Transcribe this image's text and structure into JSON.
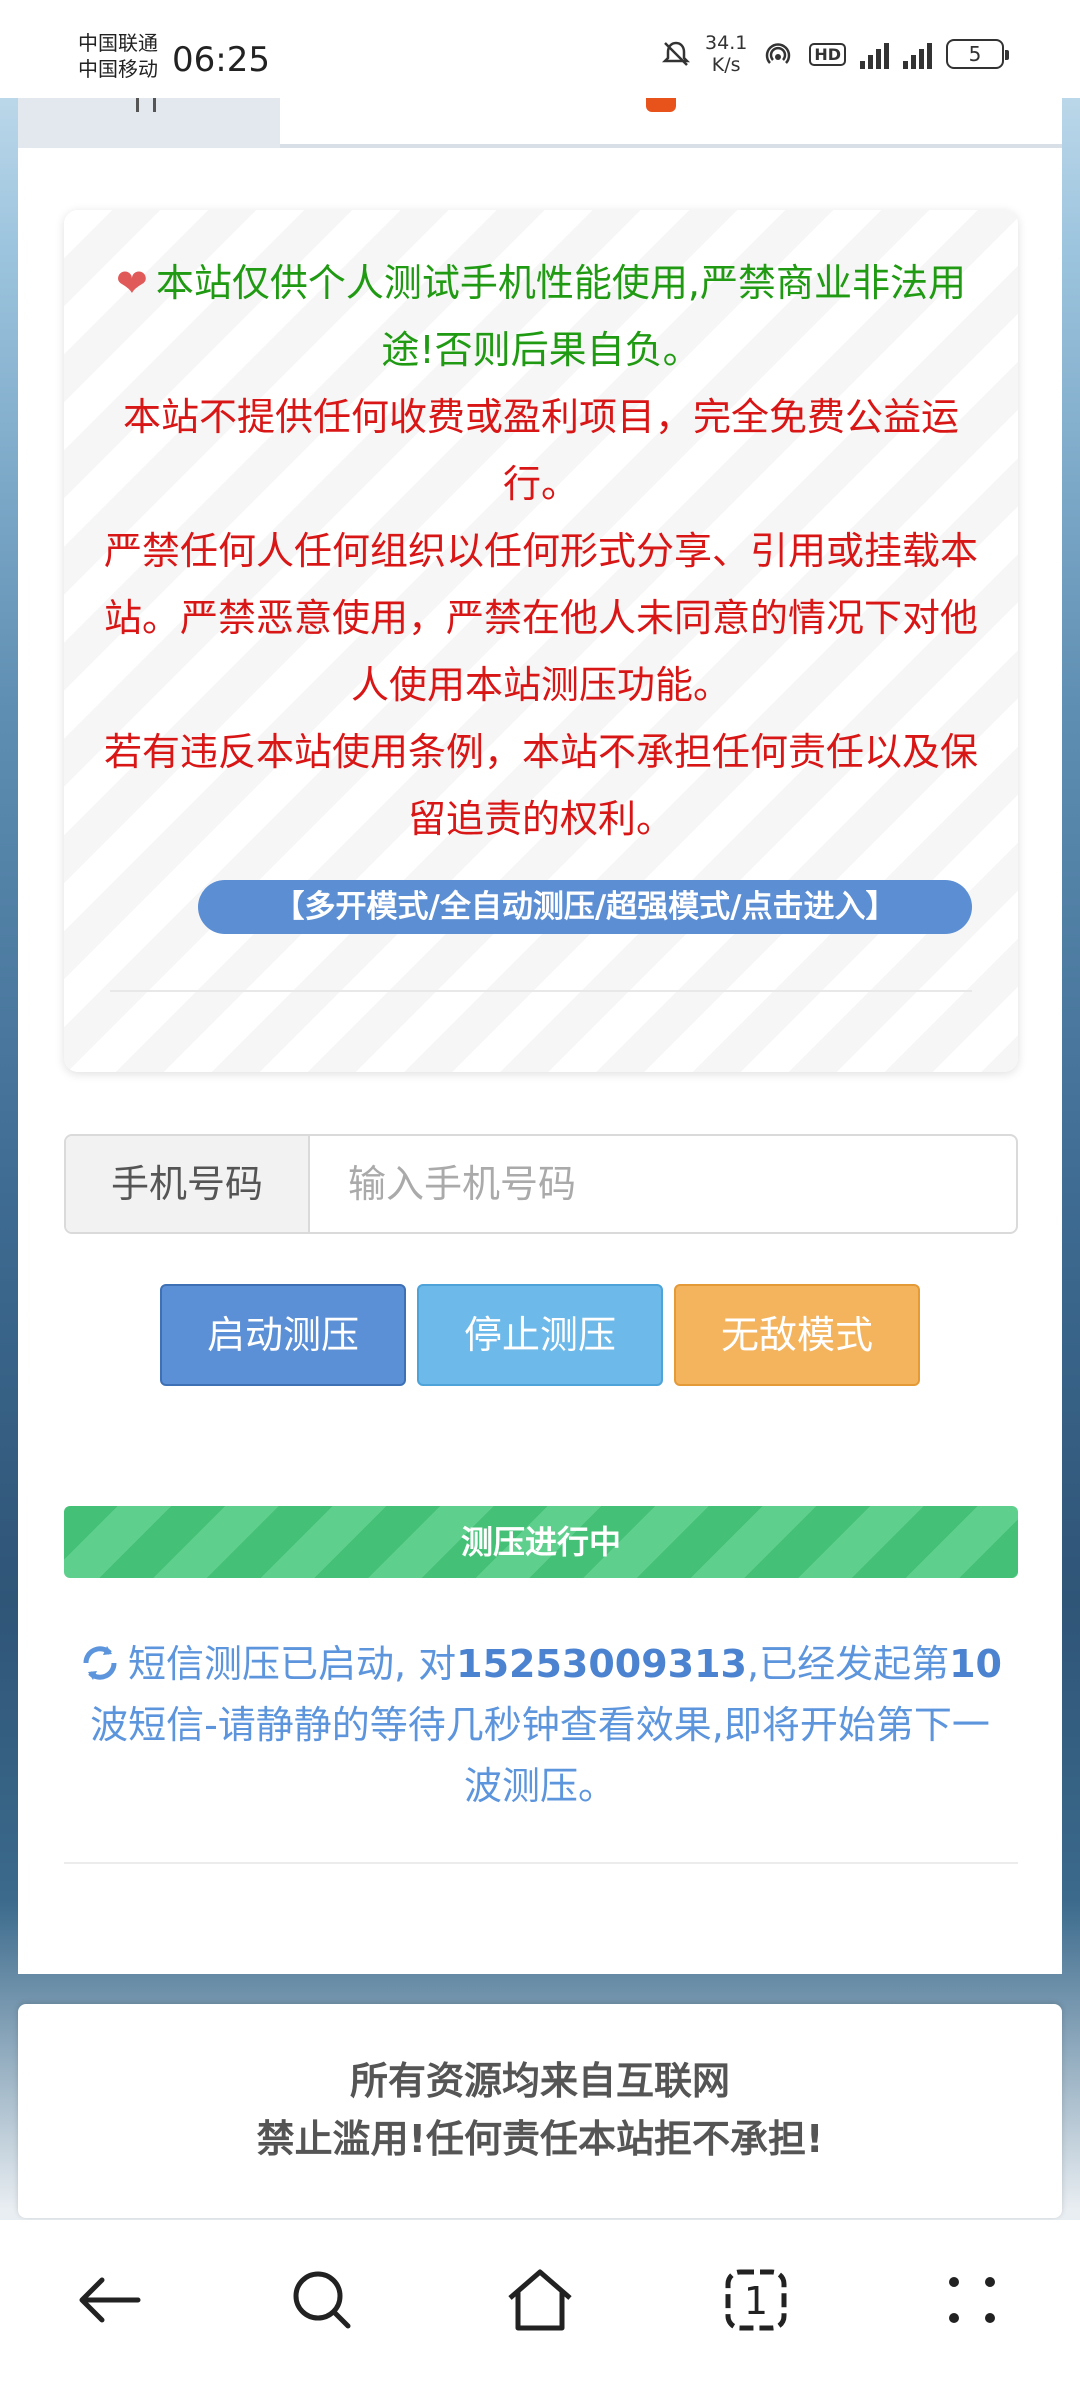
{
  "status_bar": {
    "carrier_1": "中国联通",
    "carrier_2": "中国移动",
    "time": "06:25",
    "speed_value": "34.1",
    "speed_unit": "K/s",
    "battery": "5"
  },
  "notice": {
    "line_green": "本站仅供个人测试手机性能使用,严禁商业非法用途!否则后果自负。",
    "line_red_1": "本站不提供任何收费或盈利项目，完全免费公益运行。",
    "line_red_2": "严禁任何人任何组织以任何形式分享、引用或挂载本站。严禁恶意使用，严禁在他人未同意的情况下对他人使用本站测压功能。",
    "line_red_3": "若有违反本站使用条例，本站不承担任何责任以及保留追责的权利。",
    "mode_link": "【多开模式/全自动测压/超强模式/点击进入】"
  },
  "phone": {
    "label": "手机号码",
    "placeholder": "输入手机号码",
    "value": ""
  },
  "buttons": {
    "start": "启动测压",
    "stop": "停止测压",
    "invincible": "无敌模式"
  },
  "progress": {
    "label": "测压进行中",
    "percent": 100
  },
  "status": {
    "prefix": "短信测压已启动, 对",
    "phone_number": "15253009313",
    "middle": ",已经发起第",
    "wave_count": "10",
    "suffix": "波短信-请静静的等待几秒钟查看效果,即将开始第下一波测压。"
  },
  "footer": {
    "line_1": "所有资源均来自互联网",
    "line_2": "禁止滥用!任何责任本站拒不承担!"
  },
  "navbar": {
    "tab_count": "1"
  },
  "colors": {
    "start_button": "#5b8fd6",
    "stop_button": "#6cb9ea",
    "invincible_button": "#f4b45e",
    "progress_bar": "#45c177",
    "notice_green": "#1f9a12",
    "notice_red": "#d81616"
  }
}
